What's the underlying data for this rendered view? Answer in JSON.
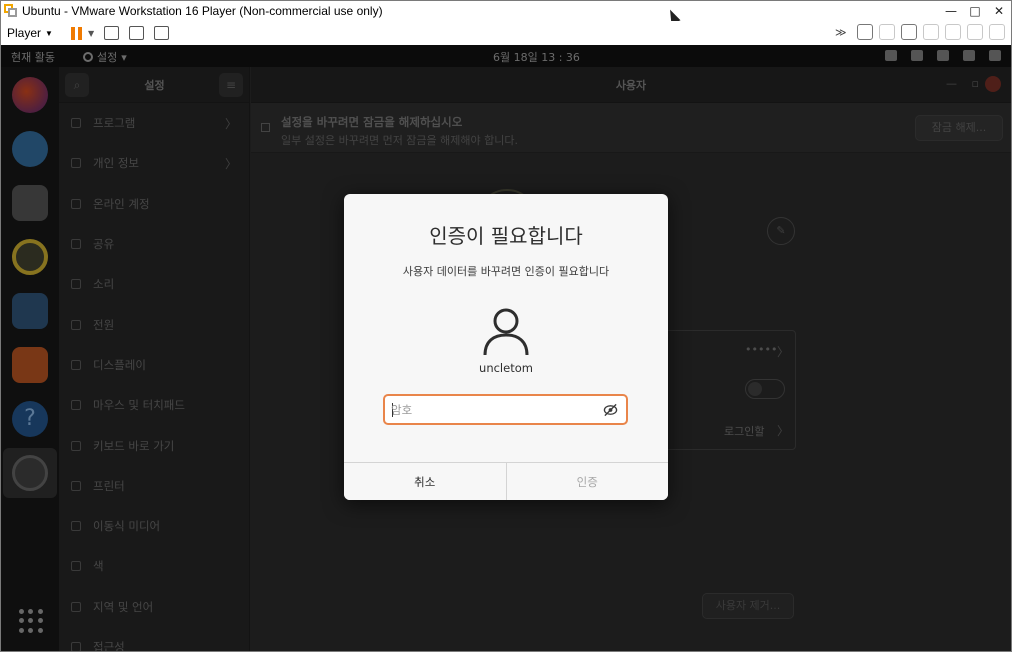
{
  "vmware": {
    "title": "Ubuntu - VMware Workstation 16 Player (Non-commercial use only)",
    "player_menu": "Player",
    "window_controls": {
      "minimize": "—",
      "maximize": "□",
      "close": "✕"
    }
  },
  "topbar": {
    "activities": "현재 활동",
    "app_menu": "설정",
    "clock": "6월 18일  13 : 36"
  },
  "dock": {
    "items": [
      "firefox-icon",
      "thunderbird-icon",
      "files-icon",
      "rhythmbox-icon",
      "writer-icon",
      "app-store-icon",
      "help-icon",
      "settings-icon",
      "show-apps-icon"
    ]
  },
  "settings": {
    "sidebar_title": "설정",
    "content_title": "사용자",
    "sidebar_items": [
      {
        "label": "프로그램",
        "chevron": "〉"
      },
      {
        "label": "개인 정보",
        "chevron": "〉"
      },
      {
        "label": "온라인 계정",
        "chevron": ""
      },
      {
        "label": "공유",
        "chevron": ""
      },
      {
        "label": "소리",
        "chevron": ""
      },
      {
        "label": "전원",
        "chevron": ""
      },
      {
        "label": "디스플레이",
        "chevron": ""
      },
      {
        "label": "마우스 및 터치패드",
        "chevron": ""
      },
      {
        "label": "키보드 바로 가기",
        "chevron": ""
      },
      {
        "label": "프린터",
        "chevron": ""
      },
      {
        "label": "이동식 미디어",
        "chevron": ""
      },
      {
        "label": "색",
        "chevron": ""
      },
      {
        "label": "지역 및 언어",
        "chevron": ""
      },
      {
        "label": "접근성",
        "chevron": ""
      }
    ],
    "lock_bar": {
      "title": "설정을 바꾸려면 잠금을 해제하십시오",
      "subtitle": "일부 설정은 바꾸려면 먼저 잠금을 해제해야 합니다.",
      "unlock_button": "잠금 해제..."
    },
    "password_dots": "•••••",
    "login_label": "로그인할",
    "remove_user_button": "사용자 제거..."
  },
  "dialog": {
    "heading": "인증이 필요합니다",
    "subtitle": "사용자 데이터를 바꾸려면 인증이 필요합니다",
    "username": "uncletom",
    "password_placeholder": "암호",
    "cancel_label": "취소",
    "authenticate_label": "인증",
    "accent_color": "#e9854a"
  }
}
